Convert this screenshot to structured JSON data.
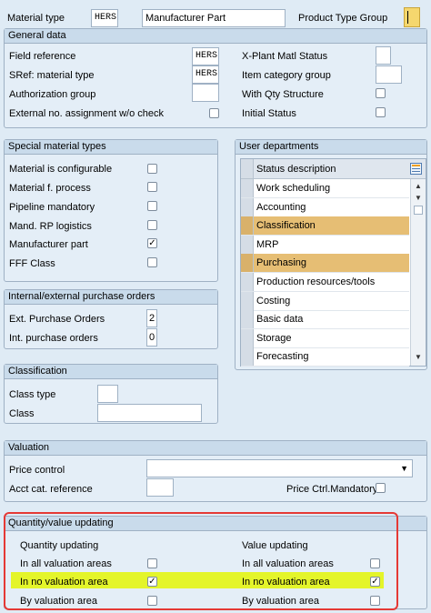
{
  "header": {
    "material_type_label": "Material type",
    "material_type_value": "HERS",
    "material_type_desc": "Manufacturer Part",
    "product_type_group_label": "Product Type Group"
  },
  "general": {
    "title": "General data",
    "field_reference_label": "Field reference",
    "field_reference_value": "HERS",
    "sref_label": "SRef: material type",
    "sref_value": "HERS",
    "auth_group_label": "Authorization group",
    "ext_no_label": "External no. assignment w/o check",
    "xplant_label": "X-Plant Matl Status",
    "item_cat_label": "Item category group",
    "qty_struct_label": "With Qty Structure",
    "initial_status_label": "Initial Status"
  },
  "special": {
    "title": "Special material types",
    "items": [
      {
        "label": "Material is configurable",
        "checked": ""
      },
      {
        "label": "Material f. process",
        "checked": ""
      },
      {
        "label": "Pipeline mandatory",
        "checked": ""
      },
      {
        "label": "Mand. RP logistics",
        "checked": ""
      },
      {
        "label": "Manufacturer part",
        "checked": "✓"
      },
      {
        "label": "FFF Class",
        "checked": ""
      }
    ]
  },
  "user_departments": {
    "title": "User departments",
    "column_header": "Status description",
    "rows": [
      {
        "label": "Work scheduling",
        "selected": false
      },
      {
        "label": "Accounting",
        "selected": false
      },
      {
        "label": "Classification",
        "selected": true
      },
      {
        "label": "MRP",
        "selected": false
      },
      {
        "label": "Purchasing",
        "selected": true
      },
      {
        "label": "Production resources/tools",
        "selected": false
      },
      {
        "label": "Costing",
        "selected": false
      },
      {
        "label": "Basic data",
        "selected": false
      },
      {
        "label": "Storage",
        "selected": false
      },
      {
        "label": "Forecasting",
        "selected": false
      }
    ]
  },
  "orders": {
    "title": "Internal/external purchase orders",
    "ext_label": "Ext. Purchase Orders",
    "ext_value": "2",
    "int_label": "Int. purchase orders",
    "int_value": "0"
  },
  "classification": {
    "title": "Classification",
    "class_type_label": "Class type",
    "class_label": "Class"
  },
  "valuation": {
    "title": "Valuation",
    "price_control_label": "Price control",
    "acct_cat_label": "Acct cat. reference",
    "price_ctrl_mandatory_label": "Price Ctrl.Mandatory"
  },
  "qty_value": {
    "title": "Quantity/value updating",
    "qty_heading": "Quantity updating",
    "value_heading": "Value updating",
    "rows": [
      {
        "label": "In all valuation areas",
        "qty": "",
        "value": ""
      },
      {
        "label": "In no valuation area",
        "qty": "✓",
        "value": "✓"
      },
      {
        "label": "By valuation area",
        "qty": "",
        "value": ""
      }
    ]
  },
  "colors": {
    "highlight_row": "#e6be74",
    "highlight_yellow": "#e4f52a",
    "annotation_red": "#e53935"
  }
}
